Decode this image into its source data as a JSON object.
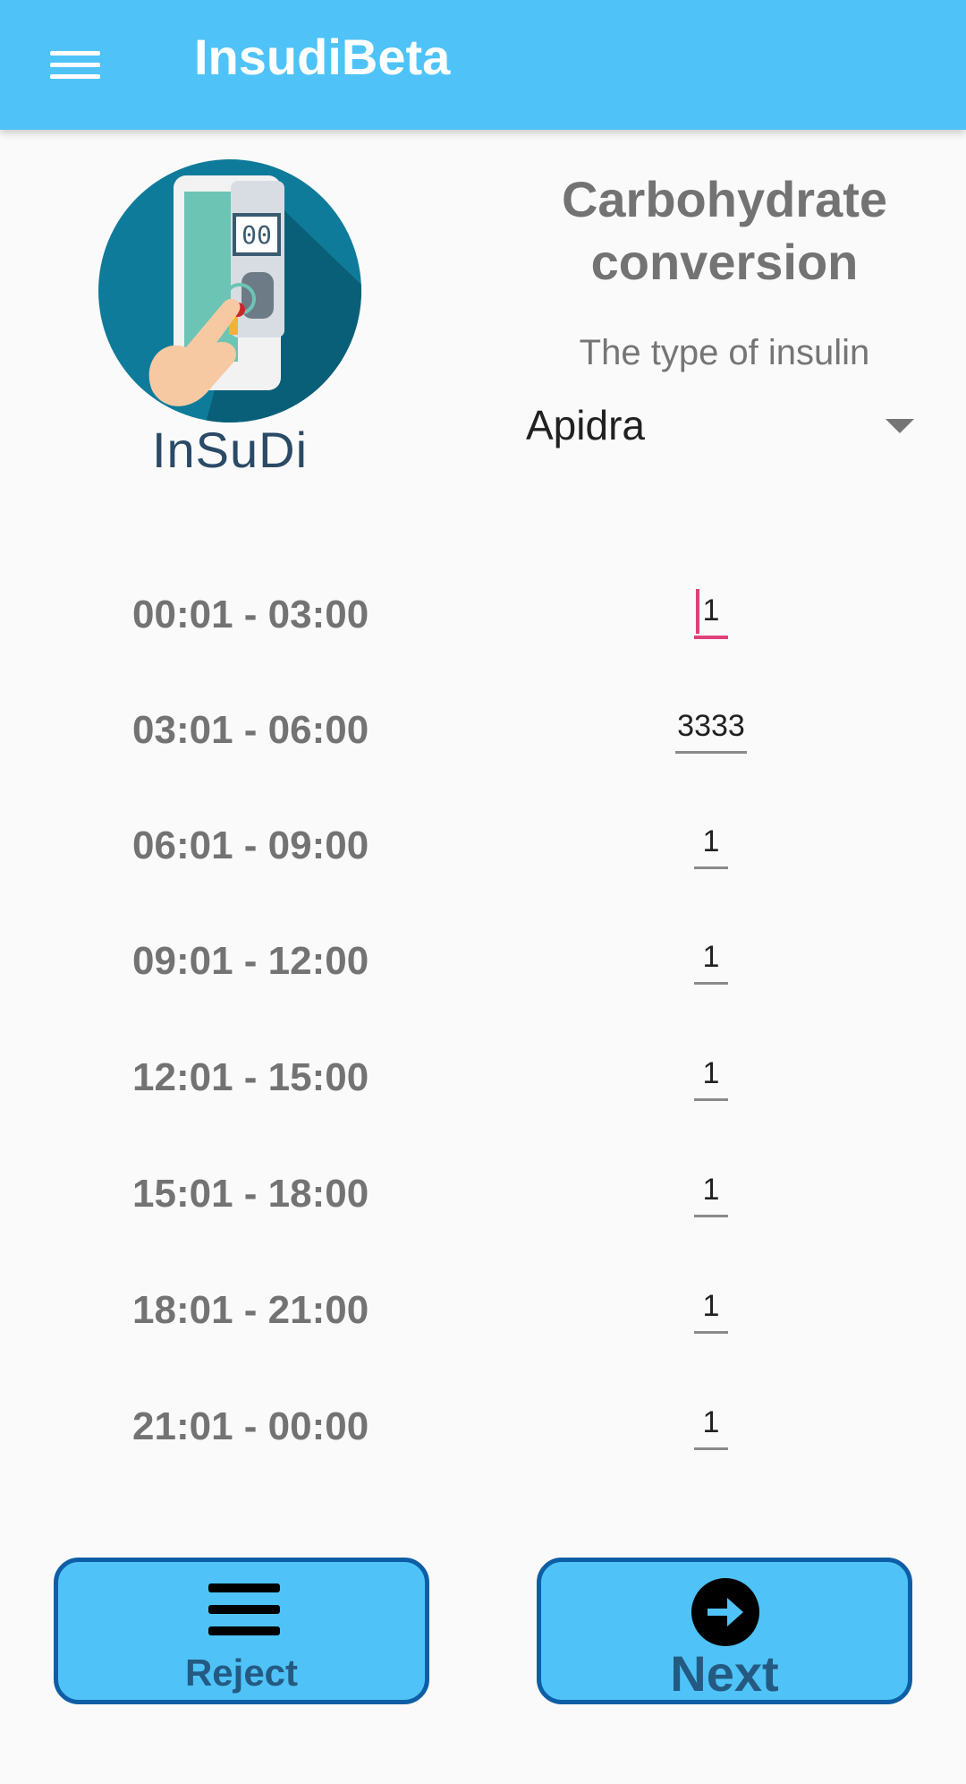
{
  "appbar": {
    "title": "InsudiBeta",
    "menu_icon": "hamburger-menu-icon"
  },
  "logo": {
    "text": "InSuDi",
    "icon": "glucometer-phone-logo"
  },
  "header": {
    "title": "Carbohydrate conversion",
    "subtitle": "The type of insulin",
    "insulin_type": "Apidra"
  },
  "rows": [
    {
      "time": "00:01 - 03:00",
      "value": "1"
    },
    {
      "time": "03:01 - 06:00",
      "value": "3333"
    },
    {
      "time": "06:01 - 09:00",
      "value": "1"
    },
    {
      "time": "09:01 - 12:00",
      "value": "1"
    },
    {
      "time": "12:01 - 15:00",
      "value": "1"
    },
    {
      "time": "15:01 - 18:00",
      "value": "1"
    },
    {
      "time": "18:01 - 21:00",
      "value": "1"
    },
    {
      "time": "21:01 - 00:00",
      "value": "1"
    }
  ],
  "buttons": {
    "reject": {
      "label": "Reject",
      "icon": "menu-lines-icon"
    },
    "next": {
      "label": "Next",
      "icon": "arrow-right-circle-icon"
    }
  },
  "colors": {
    "appbar": "#4fc3f7",
    "button_border": "#0d5ea6",
    "focus": "#e0407b"
  }
}
